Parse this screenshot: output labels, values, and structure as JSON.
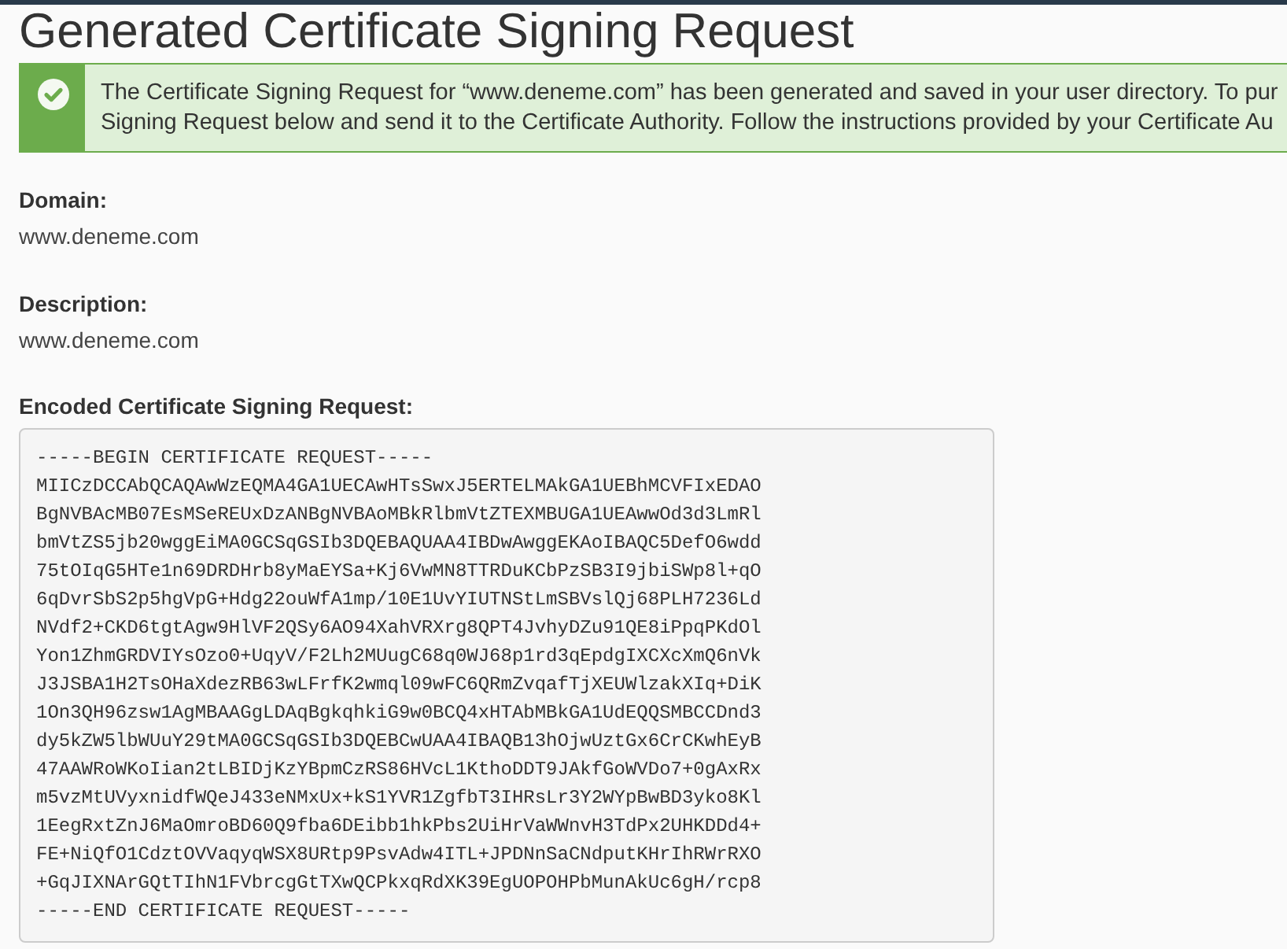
{
  "page": {
    "title": "Generated Certificate Signing Request"
  },
  "alert": {
    "kind": "success",
    "message_lines": [
      "The Certificate Signing Request for “www.deneme.com” has been generated and saved in your user directory. To pur",
      "Signing Request below and send it to the Certificate Authority. Follow the instructions provided by your Certificate Au"
    ]
  },
  "fields": [
    {
      "label": "Domain:",
      "value": "www.deneme.com"
    },
    {
      "label": "Description:",
      "value": "www.deneme.com"
    }
  ],
  "encoded_csr": {
    "label": "Encoded Certificate Signing Request:",
    "lines": [
      "-----BEGIN CERTIFICATE REQUEST-----",
      "MIICzDCCAbQCAQAwWzEQMA4GA1UECAwHTsSwxJ5ERTELMAkGA1UEBhMCVFIxEDAO",
      "BgNVBAcMB07EsMSeREUxDzANBgNVBAoMBkRlbmVtZTEXMBUGA1UEAwwOd3d3LmRl",
      "bmVtZS5jb20wggEiMA0GCSqGSIb3DQEBAQUAA4IBDwAwggEKAoIBAQC5DefO6wdd",
      "75tOIqG5HTe1n69DRDHrb8yMaEYSa+Kj6VwMN8TTRDuKCbPzSB3I9jbiSWp8l+qO",
      "6qDvrSbS2p5hgVpG+Hdg22ouWfA1mp/10E1UvYIUTNStLmSBVslQj68PLH7236Ld",
      "NVdf2+CKD6tgtAgw9HlVF2QSy6AO94XahVRXrg8QPT4JvhyDZu91QE8iPpqPKdOl",
      "Yon1ZhmGRDVIYsOzo0+UqyV/F2Lh2MUugC68q0WJ68p1rd3qEpdgIXCXcXmQ6nVk",
      "J3JSBA1H2TsOHaXdezRB63wLFrfK2wmql09wFC6QRmZvqafTjXEUWlzakXIq+DiK",
      "1On3QH96zsw1AgMBAAGgLDAqBgkqhkiG9w0BCQ4xHTAbMBkGA1UdEQQSMBCCDnd3",
      "dy5kZW5lbWUuY29tMA0GCSqGSIb3DQEBCwUAA4IBAQB13hOjwUztGx6CrCKwhEyB",
      "47AAWRoWKoIian2tLBIDjKzYBpmCzRS86HVcL1KthoDDT9JAkfGoWVDo7+0gAxRx",
      "m5vzMtUVyxnidfWQeJ433eNMxUx+kS1YVR1ZgfbT3IHRsLr3Y2WYpBwBD3yko8Kl",
      "1EegRxtZnJ6MaOmroBD60Q9fba6DEibb1hkPbs2UiHrVaWWnvH3TdPx2UHKDDd4+",
      "FE+NiQfO1CdztOVVaqyqWSX8URtp9PsvAdw4ITL+JPDNnSaCNdputKHrIhRWrRXO",
      "+GqJIXNArGQtTIhN1FVbrcgGtTXwQCPkxqRdXK39EgUOPOHPbMunAkUc6gH/rcp8",
      "-----END CERTIFICATE REQUEST-----"
    ]
  }
}
